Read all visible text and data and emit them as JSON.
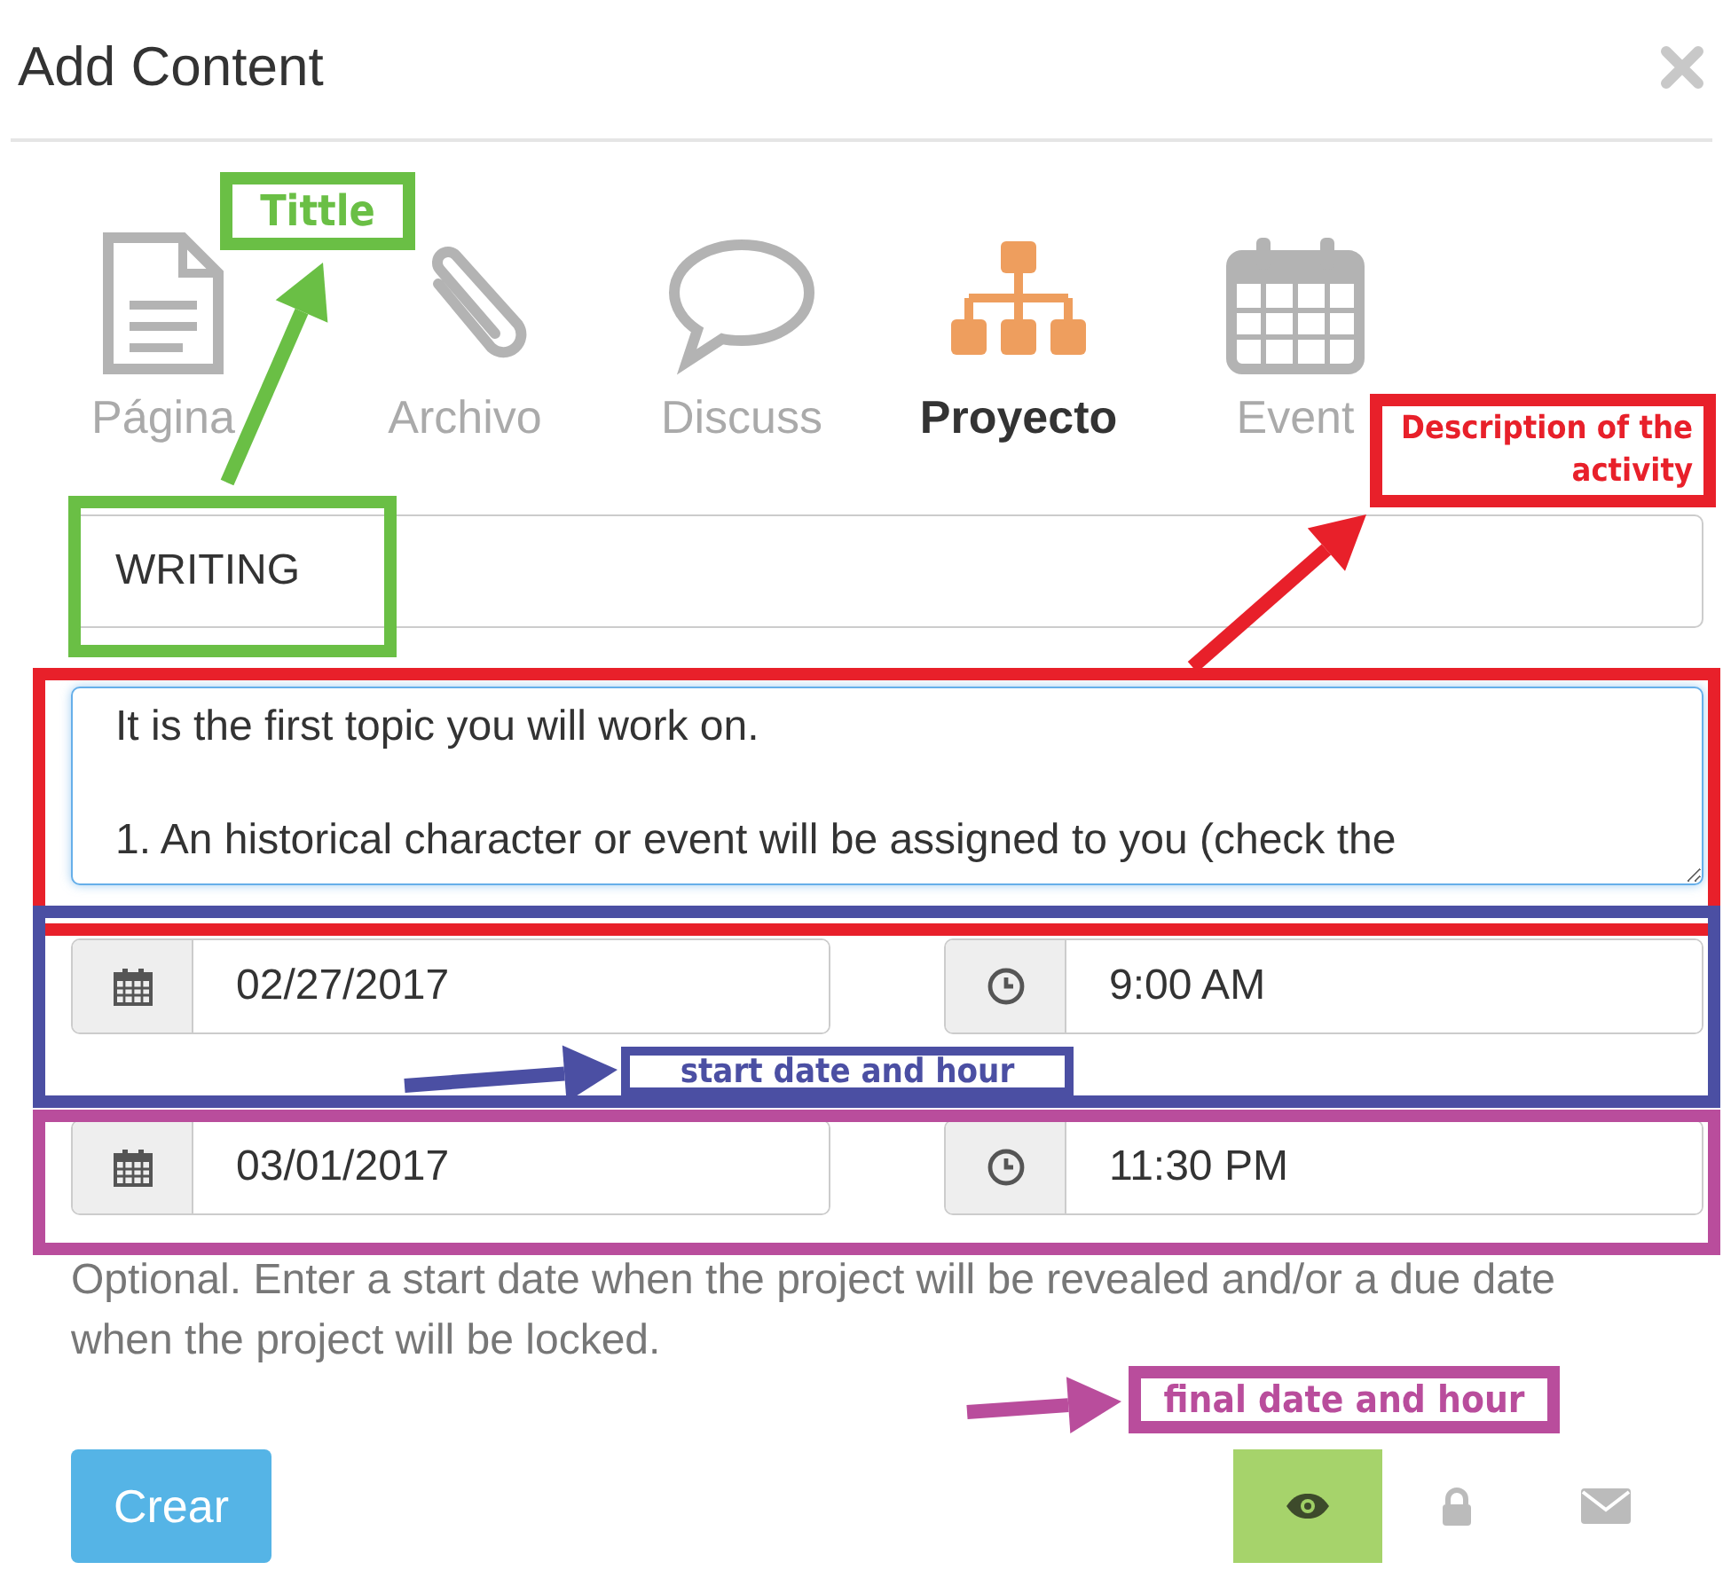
{
  "dialog": {
    "title": "Add Content"
  },
  "tabs": [
    {
      "kind": "page",
      "label": "Página",
      "selected": false
    },
    {
      "kind": "file",
      "label": "Archivo",
      "selected": false
    },
    {
      "kind": "discuss",
      "label": "Discuss",
      "selected": false
    },
    {
      "kind": "project",
      "label": "Proyecto",
      "selected": true
    },
    {
      "kind": "event",
      "label": "Event",
      "selected": false
    }
  ],
  "title_field": {
    "value": "WRITING"
  },
  "description_field": {
    "value": "It is the first topic you will work on.\n\n1. An historical character or event will be assigned to you (check the"
  },
  "start": {
    "date": "02/27/2017",
    "time": "9:00 AM"
  },
  "end": {
    "date": "03/01/2017",
    "time": "11:30 PM"
  },
  "help_text": "Optional. Enter a start date when the project will be revealed and/or a due date when the project will be locked.",
  "submit_button": "Crear",
  "visibility_toggles": [
    {
      "kind": "eye",
      "selected": true
    },
    {
      "kind": "lock",
      "selected": false
    },
    {
      "kind": "mail",
      "selected": false
    }
  ],
  "annotations": [
    {
      "text": "Tittle",
      "color": "#6abf45"
    },
    {
      "text": "Description of the activity",
      "color": "#e8202a"
    },
    {
      "text": "start date and hour",
      "color": "#4b4fa3"
    },
    {
      "text": "final date and hour",
      "color": "#b94d9c"
    }
  ]
}
